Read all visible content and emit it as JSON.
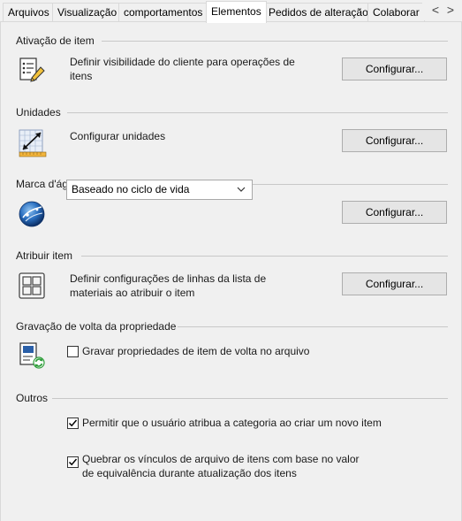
{
  "tabs": [
    {
      "label": "Arquivos",
      "active": false
    },
    {
      "label": "Visualização",
      "active": false
    },
    {
      "label": "comportamentos",
      "active": false
    },
    {
      "label": "Elementos",
      "active": true
    },
    {
      "label": "Pedidos de alteração",
      "active": false
    },
    {
      "label": "Colaborar",
      "active": false
    }
  ],
  "tab_scroll": {
    "left": "<",
    "right": ">"
  },
  "sections": {
    "item_activation": {
      "title": "Ativação de item",
      "description": "Definir visibilidade do cliente para operações de itens",
      "button": "Configurar...",
      "icon": "list-pencil-icon"
    },
    "units": {
      "title": "Unidades",
      "description": "Configurar unidades",
      "button": "Configurar...",
      "icon": "units-ruler-icon"
    },
    "watermark": {
      "title": "Marca d'água",
      "select_value": "Baseado no ciclo de vida",
      "button": "Configurar...",
      "icon": "globe-icon"
    },
    "assign_item": {
      "title": "Atribuir item",
      "description": "Definir configurações de linhas da lista de materiais ao atribuir o item",
      "button": "Configurar...",
      "icon": "grid-icon"
    },
    "property_writeback": {
      "title": "Gravação de volta da propriedade",
      "checkbox_label": "Gravar propriedades de item de volta no arquivo",
      "checked": false,
      "icon": "writeback-icon"
    },
    "other": {
      "title": "Outros",
      "options": [
        {
          "label": "Permitir que o usuário atribua a categoria ao criar um novo item",
          "checked": true
        },
        {
          "label": "Quebrar os vínculos de arquivo de itens com base no valor de equivalência durante atualização dos itens",
          "checked": true
        }
      ]
    }
  },
  "colors": {
    "panel_bg": "#f0f0f0",
    "button_bg": "#e5e5e5",
    "rule": "#c8c8c8",
    "accent_blue": "#1f5fb0"
  }
}
